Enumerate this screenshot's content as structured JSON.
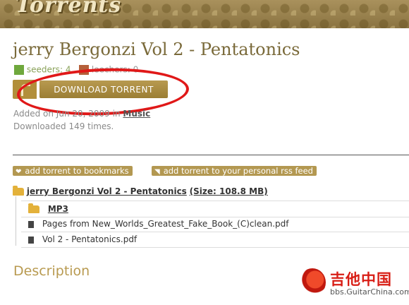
{
  "header": {
    "logo_text": "Torrents"
  },
  "torrent": {
    "title": "jerry Bergonzi Vol 2 - Pentatonics",
    "seeders_label": "seeders:",
    "seeders_count": "4",
    "leechers_label": "leechers:",
    "leechers_count": "0",
    "download_label": "DOWNLOAD TORRENT",
    "added_prefix": "Added on Jun 20, 2009 in",
    "category": "Music",
    "downloaded_text": "Downloaded 149 times."
  },
  "actions": {
    "bookmark_label": "add torrent to bookmarks",
    "rss_label": "add torrent to your personal rss feed"
  },
  "files": {
    "root_name": "jerry Bergonzi Vol 2 - Pentatonics",
    "root_size": "(Size: 108.8 MB)",
    "items": [
      {
        "name": "MP3",
        "type": "folder"
      },
      {
        "name": "Pages from New_Worlds_Greatest_Fake_Book_(C)clean.pdf",
        "type": "file"
      },
      {
        "name": "Vol 2 - Pentatonics.pdf",
        "type": "file"
      }
    ]
  },
  "description_heading": "Description",
  "watermark": {
    "cn_text": "吉他中国",
    "url": "bbs.GuitarChina.com"
  },
  "colors": {
    "accent_gold": "#b39851",
    "highlight_red": "#e01818",
    "title_brown": "#7a6a3a"
  }
}
